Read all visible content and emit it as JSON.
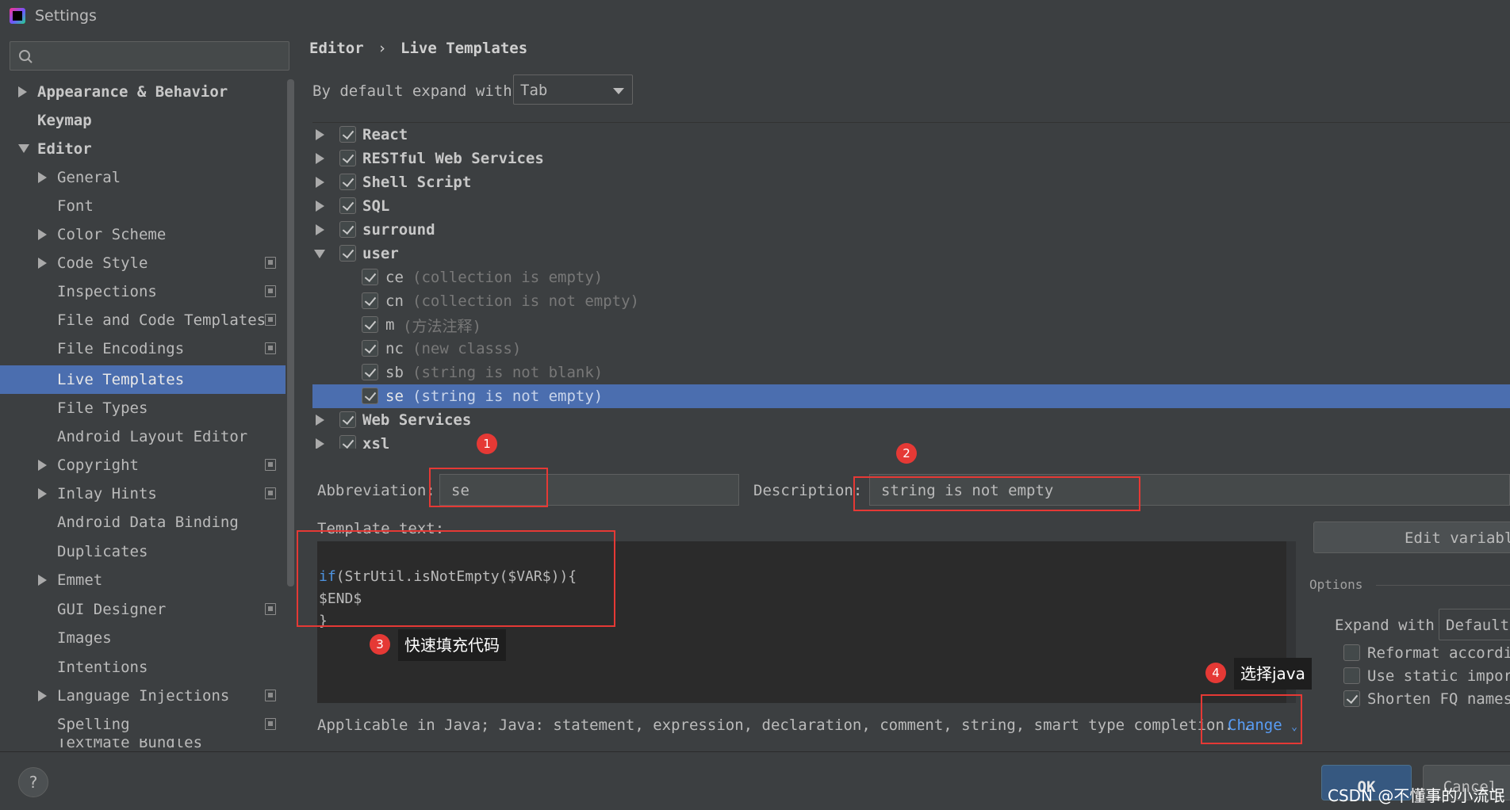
{
  "window": {
    "title": "Settings"
  },
  "breadcrumb": {
    "part1": "Editor",
    "sep": "›",
    "part2": "Live Templates"
  },
  "expand_default": {
    "label": "By default expand with",
    "value": "Tab"
  },
  "sidebar": {
    "items": [
      {
        "label": "Appearance & Behavior"
      },
      {
        "label": "Keymap"
      },
      {
        "label": "Editor"
      },
      {
        "label": "General"
      },
      {
        "label": "Font"
      },
      {
        "label": "Color Scheme"
      },
      {
        "label": "Code Style"
      },
      {
        "label": "Inspections"
      },
      {
        "label": "File and Code Templates"
      },
      {
        "label": "File Encodings"
      },
      {
        "label": "Live Templates"
      },
      {
        "label": "File Types"
      },
      {
        "label": "Android Layout Editor"
      },
      {
        "label": "Copyright"
      },
      {
        "label": "Inlay Hints"
      },
      {
        "label": "Android Data Binding"
      },
      {
        "label": "Duplicates"
      },
      {
        "label": "Emmet"
      },
      {
        "label": "GUI Designer"
      },
      {
        "label": "Images"
      },
      {
        "label": "Intentions"
      },
      {
        "label": "Language Injections"
      },
      {
        "label": "Spelling"
      },
      {
        "label": "TextMate Bundles"
      }
    ]
  },
  "tree": {
    "groups": [
      {
        "name": "React"
      },
      {
        "name": "RESTful Web Services"
      },
      {
        "name": "Shell Script"
      },
      {
        "name": "SQL"
      },
      {
        "name": "surround"
      },
      {
        "name": "user"
      },
      {
        "name": "Web Services"
      },
      {
        "name": "xsl"
      }
    ],
    "user_templates": [
      {
        "abbr": "ce",
        "desc": "(collection is empty)"
      },
      {
        "abbr": "cn",
        "desc": "(collection is not empty)"
      },
      {
        "abbr": "m",
        "desc": "(方法注释)"
      },
      {
        "abbr": "nc",
        "desc": "(new classs)"
      },
      {
        "abbr": "sb",
        "desc": "(string is not blank)"
      },
      {
        "abbr": "se",
        "desc": "(string is not empty)"
      }
    ]
  },
  "editor": {
    "abbreviation_label": "Abbreviation:",
    "abbreviation_value": "se",
    "description_label": "Description:",
    "description_value": "string is not empty",
    "template_text_label": "Template text:",
    "code": {
      "kw": "if",
      "line1_rest": "(StrUtil.isNotEmpty($VAR$)){",
      "line2": "$END$",
      "line3": "}"
    },
    "applicable": "Applicable in Java; Java: statement, expression, declaration, comment, string, smart type completion.",
    "applicable_dot": ".",
    "change_label": "Change"
  },
  "options": {
    "edit_variables": "Edit variables",
    "title": "Options",
    "expand_with_label": "Expand with",
    "expand_with_value": "Default",
    "reformat": "Reformat according to style",
    "use_static": "Use static import if possible",
    "shorten": "Shorten FQ names"
  },
  "footer": {
    "help": "?",
    "ok": "OK",
    "cancel": "Cancel"
  },
  "annotations": {
    "b1": "1",
    "b2": "2",
    "b3": "3",
    "b4": "4",
    "tip3": "快速填充代码",
    "tip4": "选择java"
  },
  "watermark": "CSDN @不懂事的小流氓",
  "colors": {
    "selection": "#4b6eaf",
    "annotation_red": "#e53935",
    "link": "#589df6"
  }
}
